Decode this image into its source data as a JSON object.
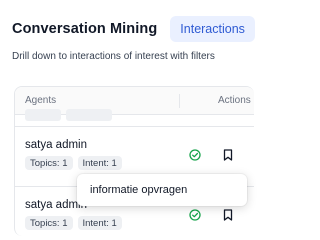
{
  "header": {
    "title": "Conversation Mining",
    "tab_label": "Interactions",
    "subtitle": "Drill down to interactions of interest with filters"
  },
  "table": {
    "columns": [
      "Agents",
      "Actions"
    ],
    "rows": [
      {
        "agent": "satya admin",
        "topics": "Topics: 1",
        "intent": "Intent: 1"
      },
      {
        "agent": "satya admin",
        "topics": "Topics: 1",
        "intent": "Intent: 1"
      }
    ]
  },
  "tooltip": {
    "text": "informatie opvragen"
  },
  "colors": {
    "accent": "#2f5bd3",
    "accent_bg": "#eaf0ff",
    "check": "#16a34a"
  },
  "icons": {
    "row_status": "check-circle-icon",
    "row_action": "bookmark-icon"
  }
}
